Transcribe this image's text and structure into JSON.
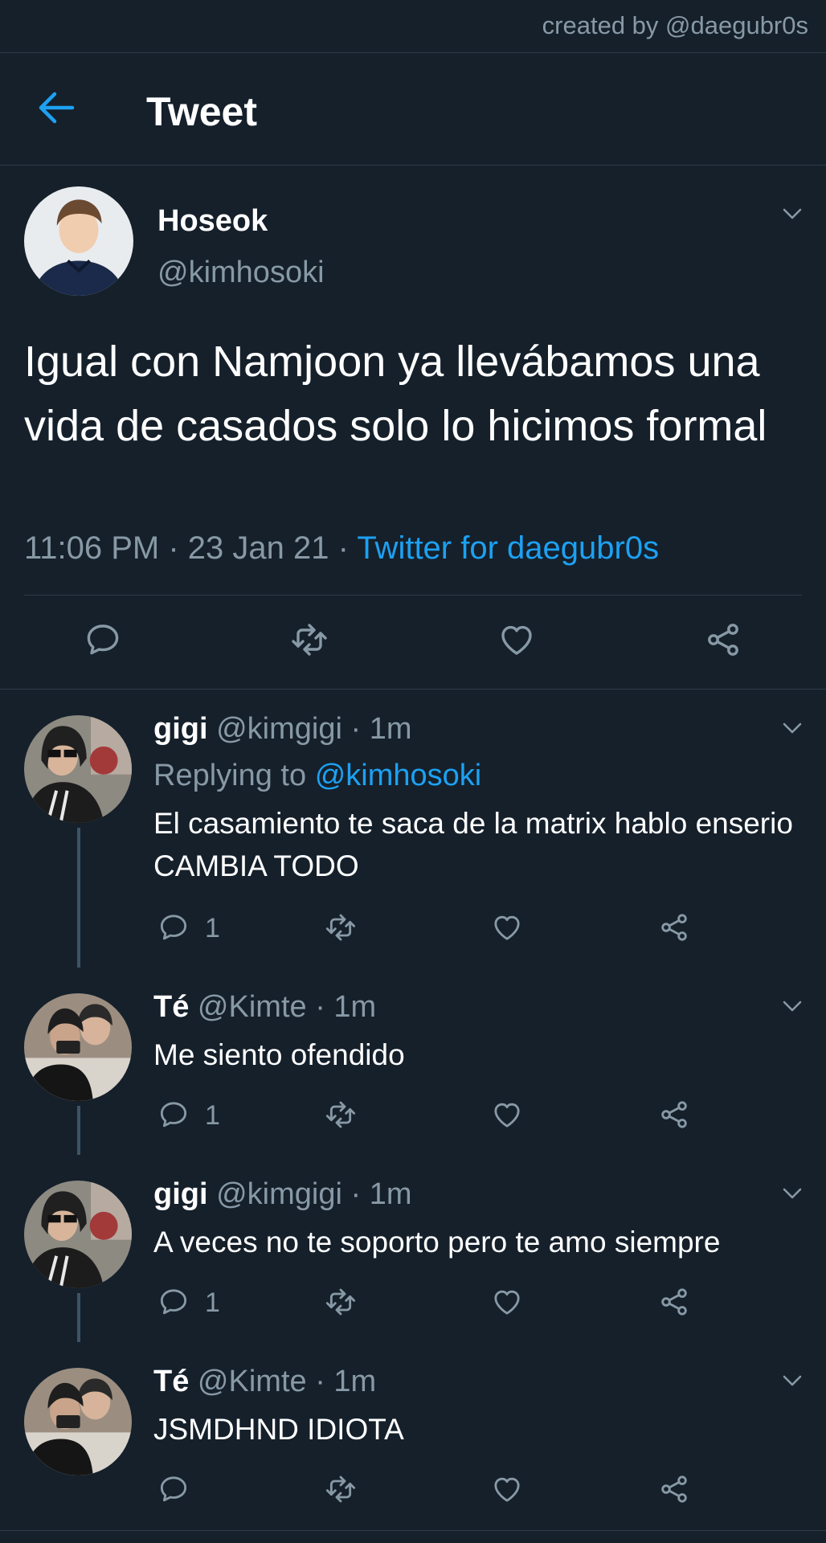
{
  "credit": "created by @daegubr0s",
  "header": {
    "title": "Tweet"
  },
  "main_tweet": {
    "name": "Hoseok",
    "handle": "@kimhosoki",
    "text": "Igual con Namjoon ya llevábamos una vida de casados solo lo hicimos formal",
    "time": "11:06 PM",
    "date": "23 Jan 21",
    "source": "Twitter for daegubr0s"
  },
  "replies": [
    {
      "name": "gigi",
      "handle": "@kimgigi",
      "time": "1m",
      "replying_label": "Replying to",
      "replying_to": "@kimhosoki",
      "text": "El casamiento te saca de la matrix hablo enserio CAMBIA TODO",
      "reply_count": "1"
    },
    {
      "name": "Té",
      "handle": "@Kimte",
      "time": "1m",
      "text": "Me siento ofendido",
      "reply_count": "1"
    },
    {
      "name": "gigi",
      "handle": "@kimgigi",
      "time": "1m",
      "text": "A veces no te soporto pero te amo siempre",
      "reply_count": "1"
    },
    {
      "name": "Té",
      "handle": "@Kimte",
      "time": "1m",
      "text": "JSMDHND IDIOTA",
      "reply_count": ""
    }
  ],
  "colors": {
    "background": "#15202b",
    "accent": "#1da1f2",
    "muted": "#8899a6",
    "divider": "#2f3b47"
  },
  "icons": [
    "back-arrow-icon",
    "chevron-down-icon",
    "comment-icon",
    "retweet-icon",
    "heart-icon",
    "share-icon"
  ]
}
